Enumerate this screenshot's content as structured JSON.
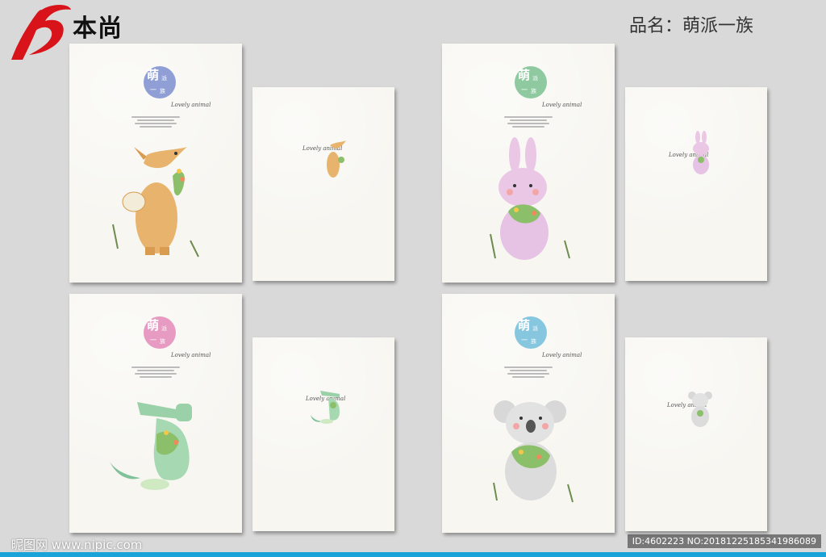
{
  "header": {
    "brand_name": "本尚",
    "product_label": "品名：萌派一族"
  },
  "badge": {
    "char_main": "萌",
    "char_side": "派",
    "char_bottom": "一",
    "char_bottom2": "族"
  },
  "signature": "Lovely animal",
  "covers": [
    {
      "animal": "fox",
      "badge_color": "#8f9fd6"
    },
    {
      "animal": "rabbit",
      "badge_color": "#8ec9a0"
    },
    {
      "animal": "crocodile",
      "badge_color": "#e79ac2"
    },
    {
      "animal": "koala",
      "badge_color": "#86c6df"
    }
  ],
  "watermark": {
    "left": "昵图网 www.nipic.com",
    "right": "ID:4602223 NO:20181225185341986089"
  },
  "colors": {
    "background": "#d9d9d9",
    "logo_red": "#d8131a",
    "bottom_bar": "#1aa3d8"
  }
}
